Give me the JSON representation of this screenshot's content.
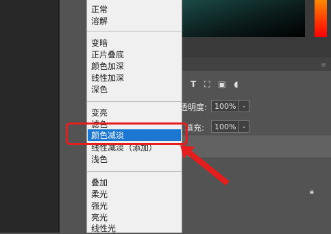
{
  "menu": {
    "group1": [
      "正常",
      "溶解"
    ],
    "group2": [
      "变暗",
      "正片叠底",
      "颜色加深",
      "线性加深",
      "深色"
    ],
    "group3": [
      "变亮",
      "滤色",
      "颜色减淡",
      "线性减淡（添加）",
      "浅色"
    ],
    "group4": [
      "叠加",
      "柔光",
      "强光",
      "亮光",
      "线性光"
    ],
    "selected": "颜色减淡"
  },
  "panel": {
    "opacity_label": "透明度:",
    "opacity_value": "100%",
    "fill_label": "填充:",
    "fill_value": "100%"
  },
  "colors": {
    "highlight": "#1c77d3",
    "annotation": "#e41e1e"
  }
}
